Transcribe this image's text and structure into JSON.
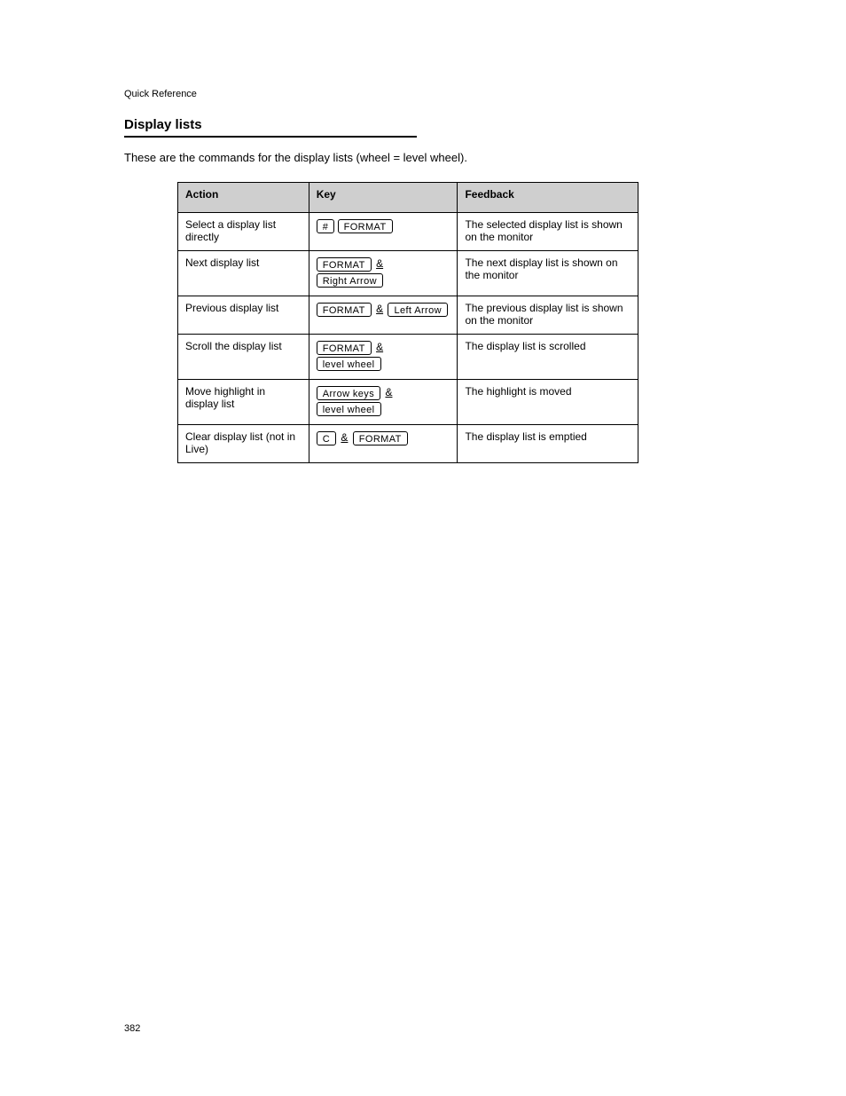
{
  "header": {
    "running": "Quick Reference",
    "title": "Display lists",
    "intro": "These are the commands for the display lists (wheel = level wheel)."
  },
  "table": {
    "cols": {
      "action": "Action",
      "key": "Key",
      "feedback": "Feedback"
    },
    "rows": [
      {
        "action": "Select a display list directly",
        "keys": [
          [
            "#",
            "FORMAT"
          ]
        ],
        "feedback": "The selected display list is shown on the monitor"
      },
      {
        "action": "Next display list",
        "keys": [
          [
            "FORMAT",
            "&",
            "Right Arrow"
          ]
        ],
        "feedback": "The next display list is shown on the monitor"
      },
      {
        "action": "Previous display list",
        "keys": [
          [
            "FORMAT",
            "&",
            "Left Arrow"
          ]
        ],
        "feedback": "The previous display list is shown on the monitor"
      },
      {
        "action": "Scroll the display list",
        "keys": [
          [
            "FORMAT",
            "&",
            "level wheel"
          ]
        ],
        "feedback": "The display list is scrolled"
      },
      {
        "action": "Move highlight in display list",
        "keys": [
          [
            "Arrow keys",
            "&",
            "level wheel"
          ]
        ],
        "feedback": "The highlight is moved"
      },
      {
        "action": "Clear display list (not in Live)",
        "keys": [
          [
            "C",
            "&",
            "FORMAT"
          ]
        ],
        "feedback": "The display list is emptied"
      }
    ]
  },
  "footer": "382"
}
